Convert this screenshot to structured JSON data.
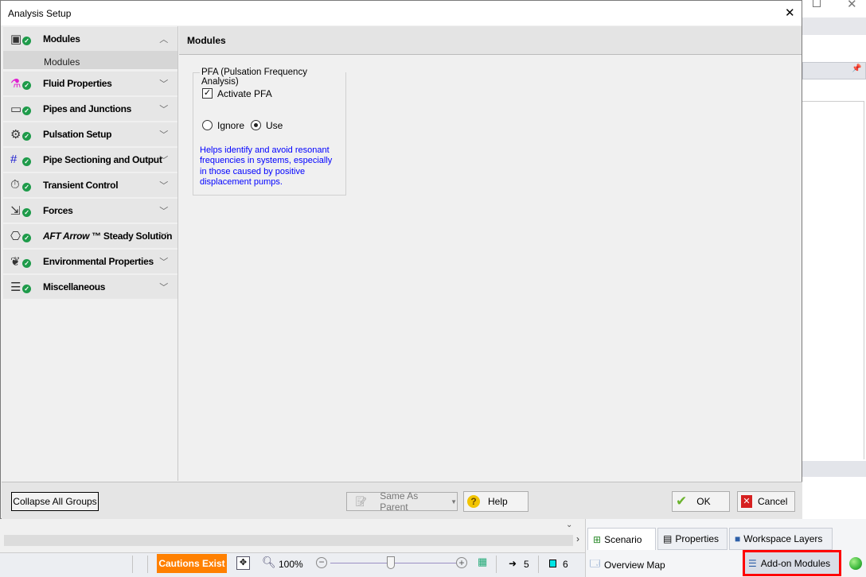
{
  "dialog": {
    "title": "Analysis Setup",
    "close": "✕"
  },
  "nav": {
    "items": [
      {
        "label": "Modules",
        "icon": "modules-icon",
        "expanded": true,
        "sub": [
          "Modules"
        ]
      },
      {
        "label": "Fluid Properties",
        "icon": "flask-icon"
      },
      {
        "label": "Pipes and Junctions",
        "icon": "pipe-icon"
      },
      {
        "label": "Pulsation Setup",
        "icon": "pulsation-icon"
      },
      {
        "label": "Pipe Sectioning and Output",
        "icon": "grid-icon"
      },
      {
        "label": "Transient Control",
        "icon": "stopwatch-icon"
      },
      {
        "label": "Forces",
        "icon": "forces-icon"
      },
      {
        "label": "AFT Arrow",
        "label2": "™ Steady Solution",
        "icon": "flowchart-icon"
      },
      {
        "label": "Environmental Properties",
        "icon": "leaf-icon"
      },
      {
        "label": "Miscellaneous",
        "icon": "list-icon"
      }
    ]
  },
  "main": {
    "title": "Modules",
    "group": {
      "title": "PFA (Pulsation Frequency Analysis)",
      "activate_label": "Activate PFA",
      "activate_checked": true,
      "radio": [
        {
          "label": "Ignore",
          "selected": false
        },
        {
          "label": "Use",
          "selected": true
        }
      ],
      "help_text": "Helps identify and avoid resonant frequencies in systems, especially in those caused by positive displacement pumps."
    }
  },
  "footer": {
    "collapse": "Collapse All Groups",
    "same_as_parent": "Same As Parent",
    "help": "Help",
    "ok": "OK",
    "cancel": "Cancel"
  },
  "app": {
    "tabs": [
      "Scenario",
      "Properties",
      "Workspace Layers"
    ],
    "overview": "Overview Map",
    "addon": "Add-on Modules",
    "status": {
      "cautions": "Cautions Exist",
      "zoom": "100%",
      "pipes": "5",
      "junctions": "6"
    },
    "colors": {
      "cautions": "#ff8000",
      "highlight": "#ff0000",
      "link_text": "#0000ff",
      "status_ok": "#3cb83c"
    }
  }
}
